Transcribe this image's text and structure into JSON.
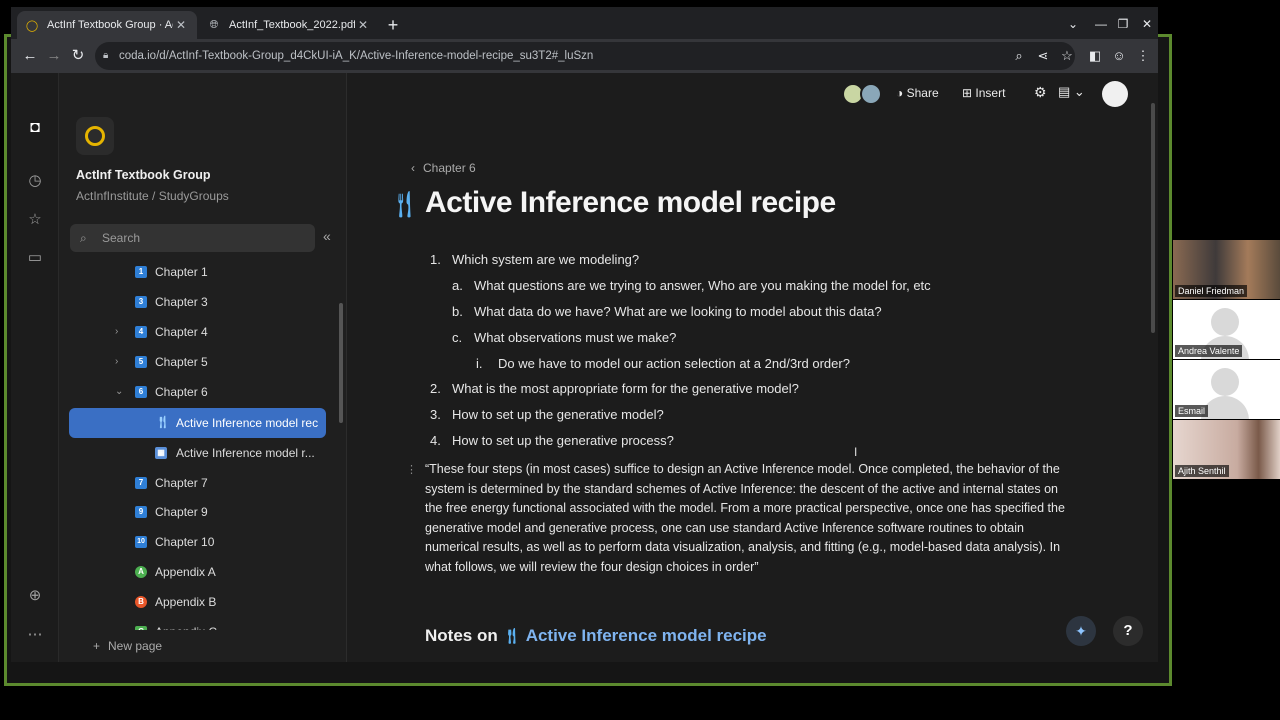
{
  "browser": {
    "tabs": [
      {
        "title": "ActInf Textbook Group · ActI",
        "active": true
      },
      {
        "title": "ActInf_Textbook_2022.pdf",
        "active": false
      }
    ],
    "url": "coda.io/d/ActInf-Textbook-Group_d4CkUI-iA_K/Active-Inference-model-recipe_su3T2#_luSzn"
  },
  "sidebar": {
    "doc_name": "ActInf Textbook Group",
    "doc_path": "ActInfInstitute / StudyGroups",
    "search_placeholder": "Search",
    "items": [
      {
        "label": "Chapter 1",
        "icon": "1",
        "color": "#2f7fd6"
      },
      {
        "label": "Chapter 3",
        "icon": "3",
        "color": "#2f7fd6"
      },
      {
        "label": "Chapter 4",
        "icon": "4",
        "color": "#2f7fd6",
        "chevron": "›"
      },
      {
        "label": "Chapter 5",
        "icon": "5",
        "color": "#2f7fd6",
        "chevron": "›"
      },
      {
        "label": "Chapter 6",
        "icon": "6",
        "color": "#2f7fd6",
        "chevron": "⌄"
      },
      {
        "label": "Active Inference model rec",
        "icon": "fork-knife-icon",
        "selected": true
      },
      {
        "label": "Active Inference model r...",
        "icon": "table-icon"
      },
      {
        "label": "Chapter 7",
        "icon": "7",
        "color": "#2f7fd6"
      },
      {
        "label": "Chapter 9",
        "icon": "9",
        "color": "#2f7fd6"
      },
      {
        "label": "Chapter 10",
        "icon": "10",
        "color": "#2f7fd6"
      },
      {
        "label": "Appendix A",
        "icon": "A",
        "color": "#4caf50"
      },
      {
        "label": "Appendix B",
        "icon": "B",
        "color": "#e8572a"
      },
      {
        "label": "Appendix C",
        "icon": "C",
        "color": "#4caf50"
      }
    ],
    "new_page": "New page"
  },
  "toolbar": {
    "share": "Share",
    "insert": "Insert"
  },
  "page": {
    "breadcrumb": "Chapter 6",
    "title": "Active Inference model recipe",
    "list": [
      {
        "marker": "1.",
        "text": "Which system are we modeling?"
      },
      {
        "marker": "a.",
        "text": "What questions are we trying to answer, Who are you making the model for, etc"
      },
      {
        "marker": "b.",
        "text": "What data do we have? What are we looking to model about this data?"
      },
      {
        "marker": "c.",
        "text": "What observations must we make?"
      },
      {
        "marker": "i.",
        "text": "Do we have to model our action selection at a 2nd/3rd order?"
      },
      {
        "marker": "2.",
        "text": "What is the most appropriate form for the generative model?"
      },
      {
        "marker": "3.",
        "text": "How to set up the generative model?"
      },
      {
        "marker": "4.",
        "text": "How to set up the generative process?"
      }
    ],
    "quote": "“These four steps (in most cases) suffice to design an Active Inference model. Once completed, the behavior of the system is determined by the standard schemes of Active Inference: the descent of the active and internal states on the free energy functional associated with the model. From a more practical perspective, once one has specified the generative model and generative process, one can use standard Active Inference software routines to obtain numerical results, as well as to perform data visualization, analysis, and fitting (e.g., model-based data analysis). In what follows, we will review the four design choices in order”",
    "notes_prefix": "Notes on",
    "notes_link": "Active Inference model recipe",
    "help": "?"
  },
  "participants": [
    {
      "name": "Daniel Friedman"
    },
    {
      "name": "Andrea Valente"
    },
    {
      "name": "Esmail"
    },
    {
      "name": "Ajith Senthil"
    }
  ]
}
